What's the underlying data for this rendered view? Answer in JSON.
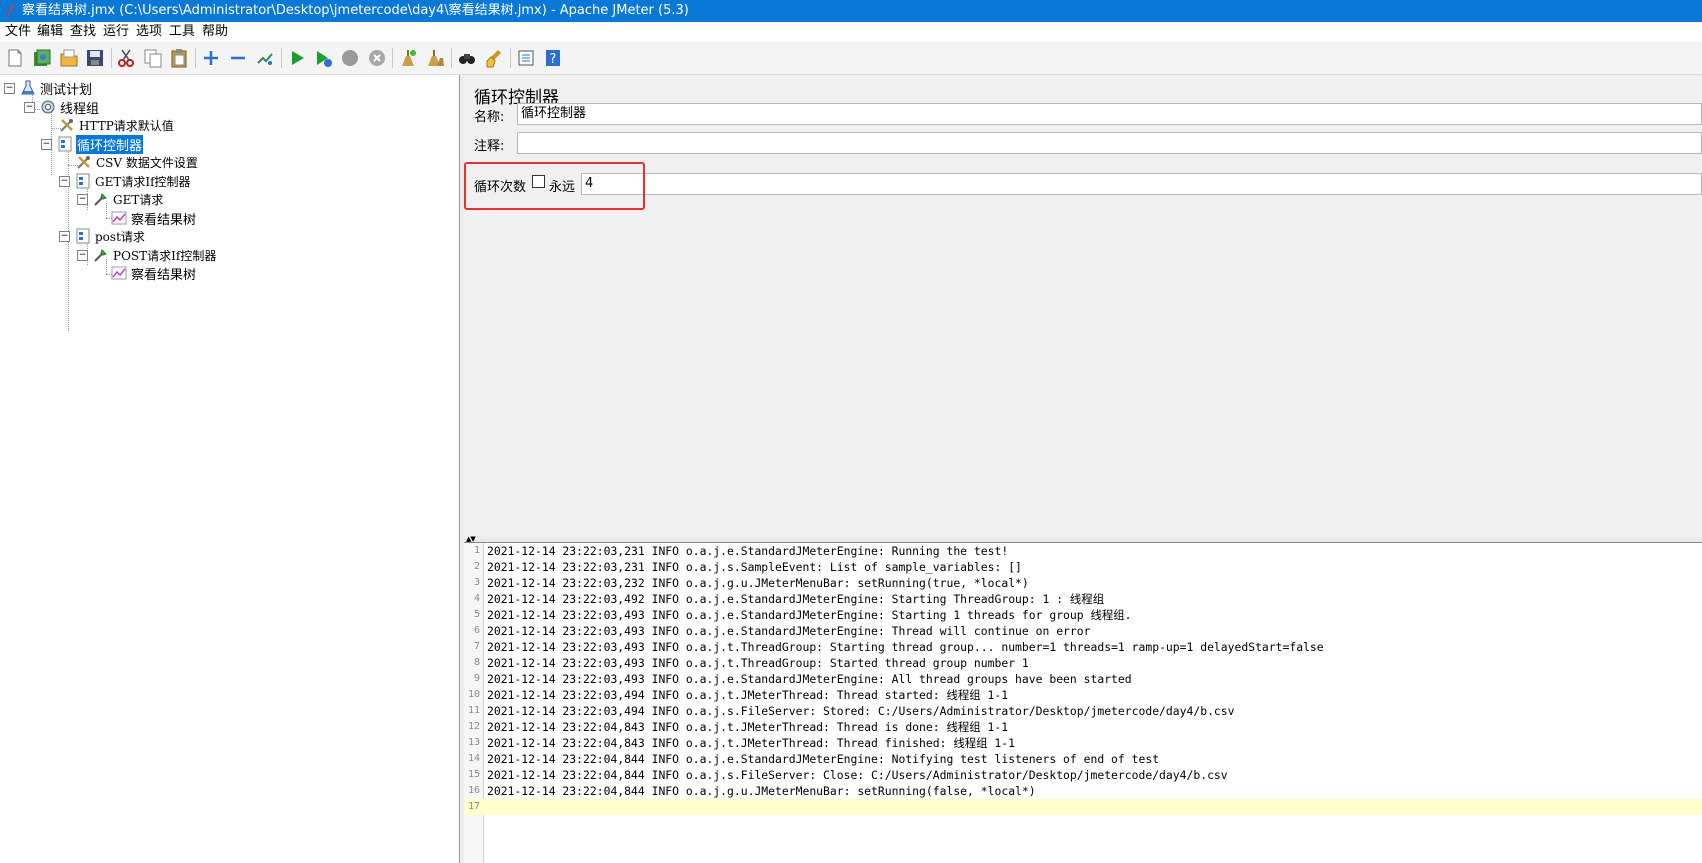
{
  "window": {
    "title": "察看结果树.jmx (C:\\Users\\Administrator\\Desktop\\jmetercode\\day4\\察看结果树.jmx) - Apache JMeter (5.3)"
  },
  "menu": [
    "文件",
    "编辑",
    "查找",
    "运行",
    "选项",
    "工具",
    "帮助"
  ],
  "toolbar": {
    "icons": [
      "new-icon",
      "templates-icon",
      "open-icon",
      "save-icon",
      "cut-icon",
      "copy-icon",
      "paste-icon",
      "expand-icon",
      "collapse-icon",
      "toggle-icon",
      "start-icon",
      "start-no-pause-icon",
      "stop-icon",
      "shutdown-icon",
      "clear-icon",
      "clear-all-icon",
      "search-icon",
      "reset-search-icon",
      "function-helper-icon",
      "help-icon"
    ]
  },
  "tree": [
    {
      "label": "测试计划",
      "icon": "test-plan-icon"
    },
    {
      "label": "线程组",
      "icon": "thread-group-icon"
    },
    {
      "label": "HTTP请求默认值",
      "icon": "config-element-icon"
    },
    {
      "label": "循环控制器",
      "icon": "controller-icon",
      "selected": true
    },
    {
      "label": "CSV 数据文件设置",
      "icon": "config-element-icon"
    },
    {
      "label": "GET请求If控制器",
      "icon": "controller-icon"
    },
    {
      "label": "GET请求",
      "icon": "sampler-icon"
    },
    {
      "label": "察看结果树",
      "icon": "listener-icon"
    },
    {
      "label": "post请求",
      "icon": "controller-icon"
    },
    {
      "label": "POST请求If控制器",
      "icon": "sampler-icon"
    },
    {
      "label": "察看结果树",
      "icon": "listener-icon"
    }
  ],
  "editor": {
    "heading": "循环控制器",
    "name_label": "名称:",
    "name_value": "循环控制器",
    "comment_label": "注释:",
    "comment_value": "",
    "loop_label": "循环次数",
    "forever_label": "永远",
    "forever_checked": false,
    "loop_value": "4"
  },
  "log": {
    "lines": [
      "2021-12-14 23:22:03,231 INFO o.a.j.e.StandardJMeterEngine: Running the test!",
      "2021-12-14 23:22:03,231 INFO o.a.j.s.SampleEvent: List of sample_variables: []",
      "2021-12-14 23:22:03,232 INFO o.a.j.g.u.JMeterMenuBar: setRunning(true, *local*)",
      "2021-12-14 23:22:03,492 INFO o.a.j.e.StandardJMeterEngine: Starting ThreadGroup: 1 : 线程组",
      "2021-12-14 23:22:03,493 INFO o.a.j.e.StandardJMeterEngine: Starting 1 threads for group 线程组.",
      "2021-12-14 23:22:03,493 INFO o.a.j.e.StandardJMeterEngine: Thread will continue on error",
      "2021-12-14 23:22:03,493 INFO o.a.j.t.ThreadGroup: Starting thread group... number=1 threads=1 ramp-up=1 delayedStart=false",
      "2021-12-14 23:22:03,493 INFO o.a.j.t.ThreadGroup: Started thread group number 1",
      "2021-12-14 23:22:03,493 INFO o.a.j.e.StandardJMeterEngine: All thread groups have been started",
      "2021-12-14 23:22:03,494 INFO o.a.j.t.JMeterThread: Thread started: 线程组 1-1",
      "2021-12-14 23:22:03,494 INFO o.a.j.s.FileServer: Stored: C:/Users/Administrator/Desktop/jmetercode/day4/b.csv",
      "2021-12-14 23:22:04,843 INFO o.a.j.t.JMeterThread: Thread is done: 线程组 1-1",
      "2021-12-14 23:22:04,843 INFO o.a.j.t.JMeterThread: Thread finished: 线程组 1-1",
      "2021-12-14 23:22:04,844 INFO o.a.j.e.StandardJMeterEngine: Notifying test listeners of end of test",
      "2021-12-14 23:22:04,844 INFO o.a.j.s.FileServer: Close: C:/Users/Administrator/Desktop/jmetercode/day4/b.csv",
      "2021-12-14 23:22:04,844 INFO o.a.j.g.u.JMeterMenuBar: setRunning(false, *local*)",
      ""
    ],
    "line_numbers": [
      "1",
      "2",
      "3",
      "4",
      "5",
      "6",
      "7",
      "8",
      "9",
      "10",
      "11",
      "12",
      "13",
      "14",
      "15",
      "16",
      "17"
    ]
  },
  "colors": {
    "title_bar": "#0a78d7",
    "selection": "#0a78d7",
    "highlight_box": "#e8302f",
    "current_line": "#ffffcc"
  }
}
